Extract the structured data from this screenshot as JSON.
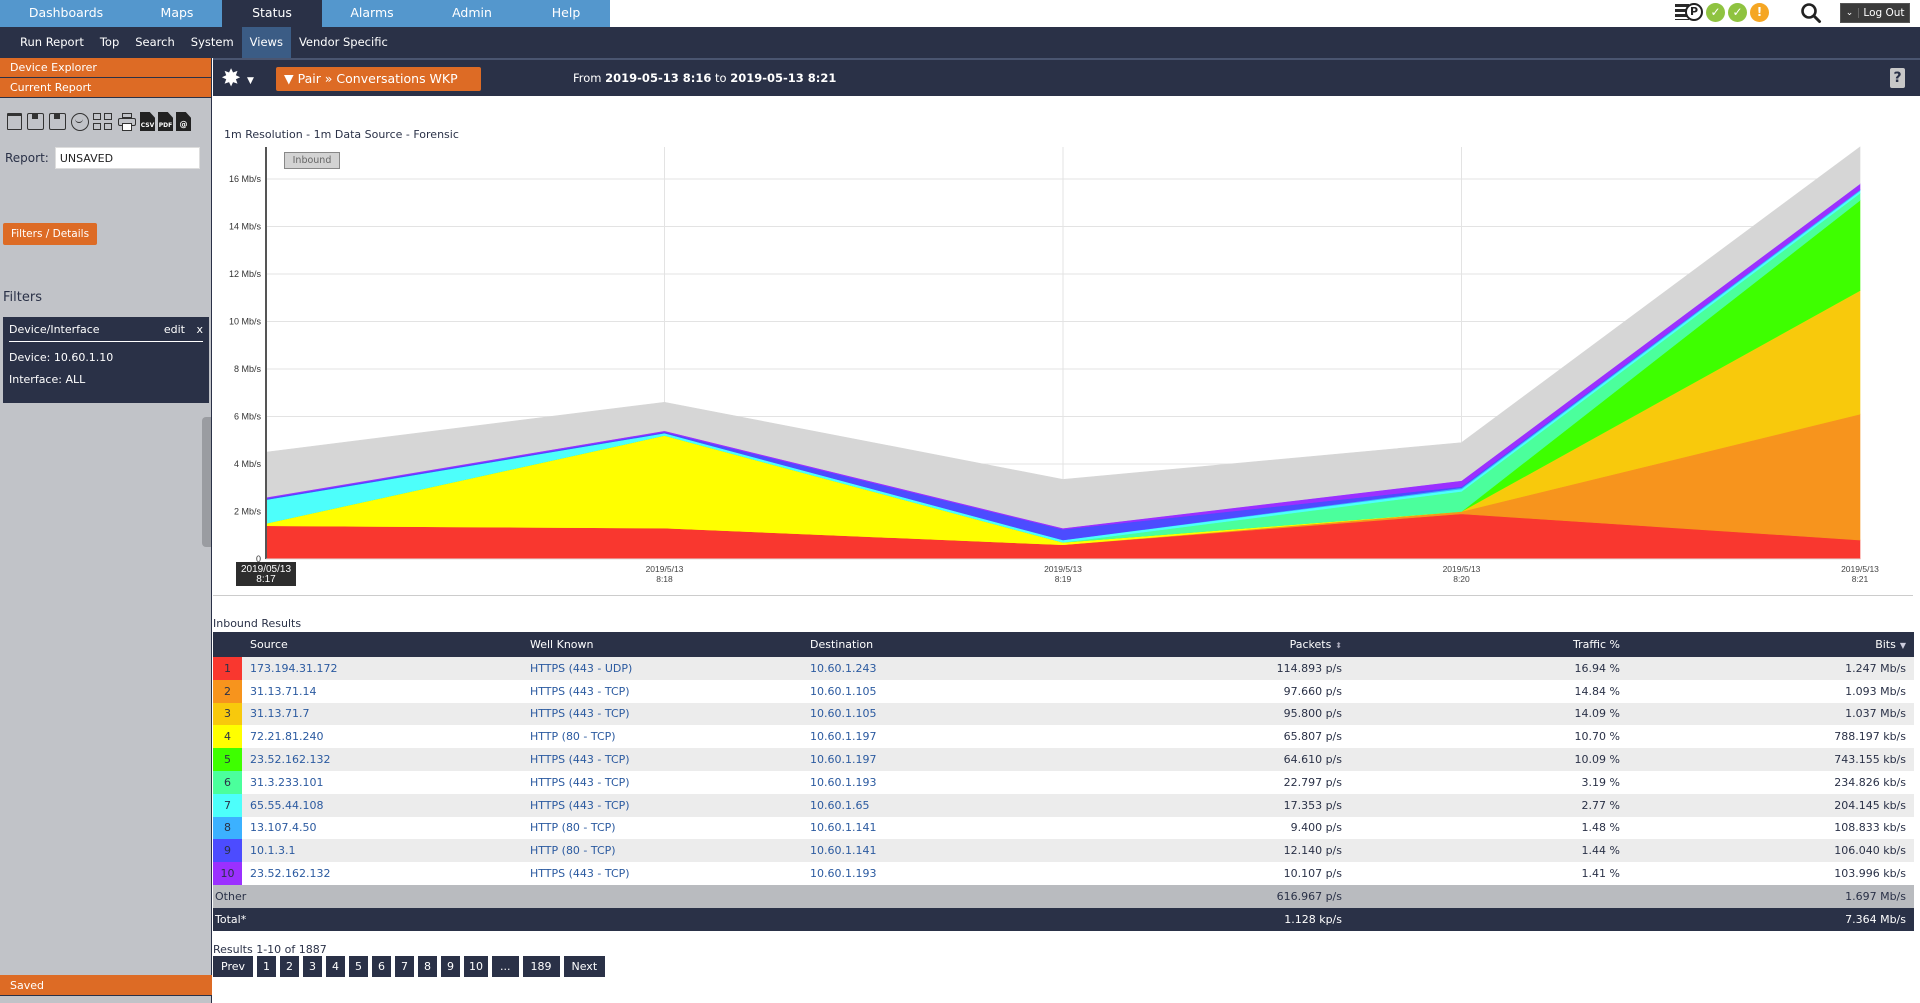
{
  "topnav": {
    "tabs": [
      {
        "label": "Dashboards",
        "active": false
      },
      {
        "label": "Maps",
        "active": false
      },
      {
        "label": "Status",
        "active": true
      },
      {
        "label": "Alarms",
        "active": false
      },
      {
        "label": "Admin",
        "active": false
      },
      {
        "label": "Help",
        "active": false
      }
    ],
    "status_icons": {
      "p_label": "P",
      "ok1": "✓",
      "ok2": "✓",
      "warn": "!"
    },
    "logout_label": "Log Out",
    "logout_chevron": "⌄"
  },
  "subnav": {
    "items": [
      {
        "label": "Run Report",
        "active": false
      },
      {
        "label": "Top",
        "active": false
      },
      {
        "label": "Search",
        "active": false
      },
      {
        "label": "System",
        "active": false
      },
      {
        "label": "Views",
        "active": true
      },
      {
        "label": "Vendor Specific",
        "active": false
      }
    ]
  },
  "sidebar": {
    "device_explorer": "Device Explorer",
    "current_report": "Current Report",
    "toolbar": {
      "csv": "CSV",
      "pdf": "PDF",
      "email": "@"
    },
    "report_label": "Report:",
    "report_value": "UNSAVED",
    "filters_button": "Filters / Details",
    "filters_heading": "Filters",
    "filter_card": {
      "title": "Device/Interface",
      "edit": "edit",
      "close": "x",
      "device": "Device: 10.60.1.10",
      "interface": "Interface: ALL"
    },
    "saved": "Saved"
  },
  "header": {
    "gear": "✸",
    "gear_caret": "▼",
    "view_button": "▼ Pair » Conversations WKP",
    "range_from_label": "From",
    "range_from": "2019-05-13 8:16",
    "range_to_label": "to",
    "range_to": "2019-05-13 8:21",
    "help": "?"
  },
  "chart_data": {
    "type": "area",
    "stacked": true,
    "title": "1m Resolution - 1m Data Source - Forensic",
    "legend": [
      "Inbound"
    ],
    "legend_placement": "top-left",
    "ylabel": "",
    "xlabel": "",
    "ylim": [
      0,
      17.35
    ],
    "y_ticks": [
      0,
      2,
      4,
      6,
      8,
      10,
      12,
      14,
      16
    ],
    "y_tick_labels": [
      "0",
      "2 Mb/s",
      "4 Mb/s",
      "6 Mb/s",
      "8 Mb/s",
      "10 Mb/s",
      "12 Mb/s",
      "14 Mb/s",
      "16 Mb/s"
    ],
    "grid": true,
    "x": [
      "2019/05/13 8:17",
      "2019/5/13 8:18",
      "2019/5/13 8:19",
      "2019/5/13 8:20",
      "2019/5/13 8:21"
    ],
    "x_tick_labels": [
      [
        "2019/05/13",
        "8:17"
      ],
      [
        "2019/5/13",
        "8:18"
      ],
      [
        "2019/5/13",
        "8:19"
      ],
      [
        "2019/5/13",
        "8:20"
      ],
      [
        "2019/5/13",
        "8:21"
      ]
    ],
    "highlighted_x_index": 0,
    "units": "Mb/s",
    "series": [
      {
        "name": "1",
        "color": "#f9372f",
        "values": [
          1.4,
          1.3,
          0.6,
          1.9,
          0.8
        ]
      },
      {
        "name": "2",
        "color": "#f7941d",
        "values": [
          0.0,
          0.0,
          0.0,
          0.1,
          5.3
        ]
      },
      {
        "name": "3",
        "color": "#f8c90c",
        "values": [
          0.0,
          0.0,
          0.0,
          0.0,
          5.2
        ]
      },
      {
        "name": "4",
        "color": "#ffff00",
        "values": [
          0.1,
          3.9,
          0.1,
          0.0,
          0.0
        ]
      },
      {
        "name": "5",
        "color": "#3eff00",
        "values": [
          0.0,
          0.0,
          0.0,
          0.0,
          3.8
        ]
      },
      {
        "name": "6",
        "color": "#4bff9c",
        "values": [
          0.0,
          0.0,
          0.0,
          0.85,
          0.3
        ]
      },
      {
        "name": "7",
        "color": "#4dfffb",
        "values": [
          1.0,
          0.1,
          0.1,
          0.1,
          0.1
        ]
      },
      {
        "name": "8",
        "color": "#3cb1ff",
        "values": [
          0.0,
          0.0,
          0.0,
          0.05,
          0.05
        ]
      },
      {
        "name": "9",
        "color": "#4c4cff",
        "values": [
          0.05,
          0.05,
          0.45,
          0.05,
          0.0
        ]
      },
      {
        "name": "10",
        "color": "#9b30ff",
        "values": [
          0.05,
          0.05,
          0.05,
          0.25,
          0.25
        ]
      },
      {
        "name": "Other",
        "color": "#d6d6d6",
        "values": [
          1.9,
          1.2,
          2.05,
          1.6,
          1.55
        ]
      }
    ]
  },
  "results": {
    "title": "Inbound Results",
    "columns": {
      "source": "Source",
      "well_known": "Well Known",
      "destination": "Destination",
      "packets": "Packets",
      "traffic": "Traffic %",
      "bits": "Bits"
    },
    "packets_sort_icon": "⬍",
    "bits_sort_icon": "▼",
    "rows": [
      {
        "rank": "1",
        "color": "#f9372f",
        "source": "173.194.31.172",
        "well_known": "HTTPS (443 - UDP)",
        "destination": "10.60.1.243",
        "packets": "114.893 p/s",
        "traffic": "16.94 %",
        "bits": "1.247 Mb/s"
      },
      {
        "rank": "2",
        "color": "#f7941d",
        "source": "31.13.71.14",
        "well_known": "HTTPS (443 - TCP)",
        "destination": "10.60.1.105",
        "packets": "97.660 p/s",
        "traffic": "14.84 %",
        "bits": "1.093 Mb/s"
      },
      {
        "rank": "3",
        "color": "#f8c90c",
        "source": "31.13.71.7",
        "well_known": "HTTPS (443 - TCP)",
        "destination": "10.60.1.105",
        "packets": "95.800 p/s",
        "traffic": "14.09 %",
        "bits": "1.037 Mb/s"
      },
      {
        "rank": "4",
        "color": "#ffff00",
        "source": "72.21.81.240",
        "well_known": "HTTP (80 - TCP)",
        "destination": "10.60.1.197",
        "packets": "65.807 p/s",
        "traffic": "10.70 %",
        "bits": "788.197 kb/s"
      },
      {
        "rank": "5",
        "color": "#3eff00",
        "source": "23.52.162.132",
        "well_known": "HTTPS (443 - TCP)",
        "destination": "10.60.1.197",
        "packets": "64.610 p/s",
        "traffic": "10.09 %",
        "bits": "743.155 kb/s"
      },
      {
        "rank": "6",
        "color": "#4bff9c",
        "source": "31.3.233.101",
        "well_known": "HTTPS (443 - TCP)",
        "destination": "10.60.1.193",
        "packets": "22.797 p/s",
        "traffic": "3.19 %",
        "bits": "234.826 kb/s"
      },
      {
        "rank": "7",
        "color": "#4dfffb",
        "source": "65.55.44.108",
        "well_known": "HTTPS (443 - TCP)",
        "destination": "10.60.1.65",
        "packets": "17.353 p/s",
        "traffic": "2.77 %",
        "bits": "204.145 kb/s"
      },
      {
        "rank": "8",
        "color": "#3cb1ff",
        "source": "13.107.4.50",
        "well_known": "HTTP (80 - TCP)",
        "destination": "10.60.1.141",
        "packets": "9.400 p/s",
        "traffic": "1.48 %",
        "bits": "108.833 kb/s"
      },
      {
        "rank": "9",
        "color": "#4c4cff",
        "source": "10.1.3.1",
        "well_known": "HTTP (80 - TCP)",
        "destination": "10.60.1.141",
        "packets": "12.140 p/s",
        "traffic": "1.44 %",
        "bits": "106.040 kb/s"
      },
      {
        "rank": "10",
        "color": "#9b30ff",
        "source": "23.52.162.132",
        "well_known": "HTTPS (443 - TCP)",
        "destination": "10.60.1.193",
        "packets": "10.107 p/s",
        "traffic": "1.41 %",
        "bits": "103.996 kb/s"
      }
    ],
    "other": {
      "label": "Other",
      "packets": "616.967 p/s",
      "bits": "1.697 Mb/s"
    },
    "total": {
      "label": "Total*",
      "packets": "1.128 kp/s",
      "bits": "7.364 Mb/s"
    },
    "count_text": "Results 1-10 of 1887",
    "pager": [
      "Prev",
      "1",
      "2",
      "3",
      "4",
      "5",
      "6",
      "7",
      "8",
      "9",
      "10",
      "...",
      "189",
      "Next"
    ]
  }
}
